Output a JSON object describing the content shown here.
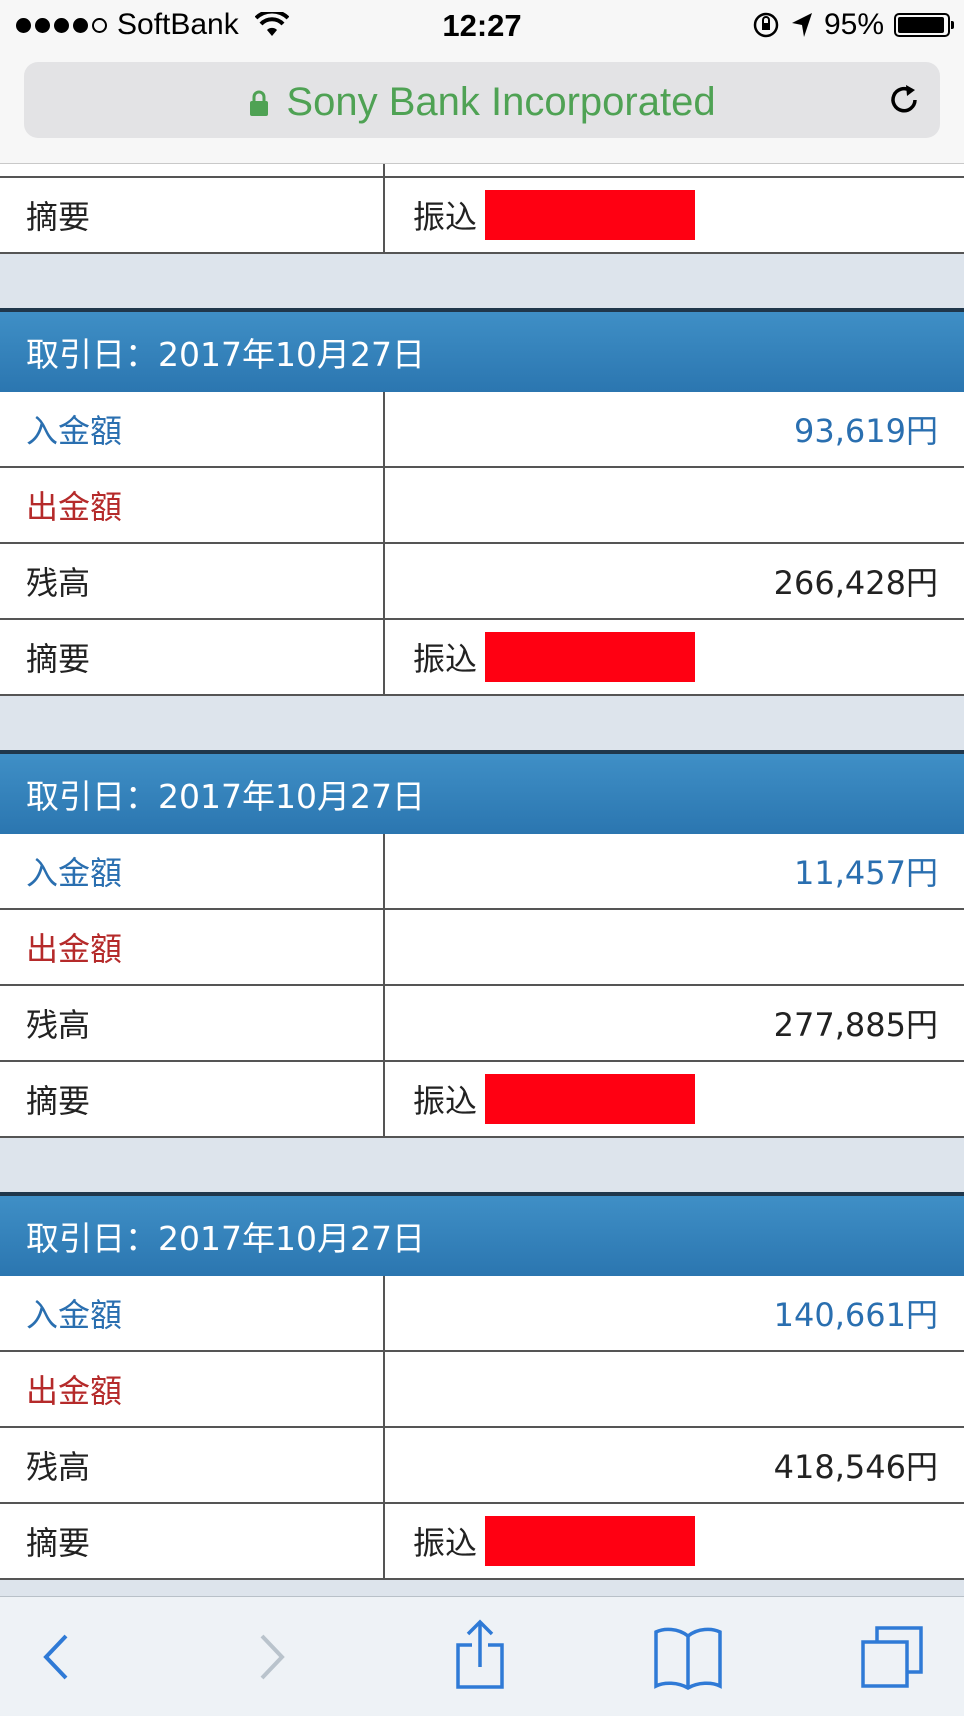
{
  "status_bar": {
    "carrier": "SoftBank",
    "time": "12:27",
    "battery_percent": "95%",
    "battery_level": 0.95
  },
  "url_bar": {
    "site_name": "Sony Bank Incorporated"
  },
  "partial_row": {
    "label": "摘要",
    "memo_prefix": "振込"
  },
  "transactions": [
    {
      "header": "取引日：2017年10月27日",
      "deposit_label": "入金額",
      "deposit_value": "93,619円",
      "withdrawal_label": "出金額",
      "withdrawal_value": "",
      "balance_label": "残高",
      "balance_value": "266,428円",
      "memo_label": "摘要",
      "memo_prefix": "振込"
    },
    {
      "header": "取引日：2017年10月27日",
      "deposit_label": "入金額",
      "deposit_value": "11,457円",
      "withdrawal_label": "出金額",
      "withdrawal_value": "",
      "balance_label": "残高",
      "balance_value": "277,885円",
      "memo_label": "摘要",
      "memo_prefix": "振込"
    },
    {
      "header": "取引日：2017年10月27日",
      "deposit_label": "入金額",
      "deposit_value": "140,661円",
      "withdrawal_label": "出金額",
      "withdrawal_value": "",
      "balance_label": "残高",
      "balance_value": "418,546円",
      "memo_label": "摘要",
      "memo_prefix": "振込"
    }
  ],
  "colors": {
    "header_blue": "#2b76b0",
    "deposit_blue": "#2a6fb0",
    "withdrawal_red": "#b52a2a",
    "redaction_red": "#ff0012",
    "url_green": "#4fa254"
  },
  "toolbar": {
    "icons": [
      "back-icon",
      "forward-icon",
      "share-icon",
      "bookmarks-icon",
      "tabs-icon"
    ]
  }
}
